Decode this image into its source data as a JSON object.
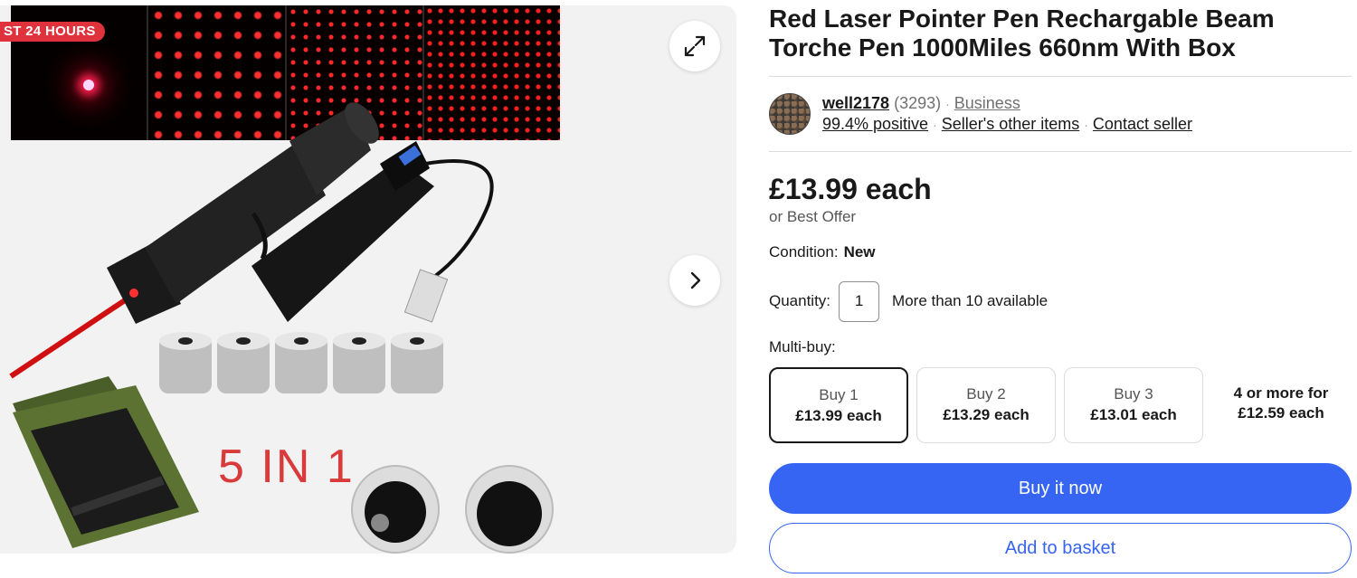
{
  "gallery": {
    "sale_badge": "ST 24 HOURS",
    "image_caption": "5 IN 1",
    "expand_icon": "expand-icon",
    "next_icon": "chevron-right-icon"
  },
  "listing": {
    "title": "Red Laser Pointer Pen Rechargable Beam Torche Pen 1000Miles 660nm With Box"
  },
  "seller": {
    "name": "well2178",
    "feedback_count": "(3293)",
    "type": "Business",
    "positive": "99.4% positive",
    "other_items": "Seller's other items",
    "contact": "Contact seller"
  },
  "pricing": {
    "price": "£13.99 each",
    "best_offer": "or Best Offer"
  },
  "condition": {
    "label": "Condition:",
    "value": "New"
  },
  "quantity": {
    "label": "Quantity:",
    "value": "1",
    "available": "More than 10 available"
  },
  "multibuy": {
    "label": "Multi-buy:",
    "tiers": [
      {
        "qty": "Buy 1",
        "price": "£13.99 each",
        "selected": true
      },
      {
        "qty": "Buy 2",
        "price": "£13.29 each",
        "selected": false
      },
      {
        "qty": "Buy 3",
        "price": "£13.01 each",
        "selected": false
      }
    ],
    "more_line1": "4 or more for",
    "more_line2": "£12.59 each"
  },
  "actions": {
    "buy_now": "Buy it now",
    "add_to_basket": "Add to basket"
  },
  "colors": {
    "accent_blue": "#3665f3",
    "sale_red": "#e0323c",
    "text": "#191919"
  }
}
